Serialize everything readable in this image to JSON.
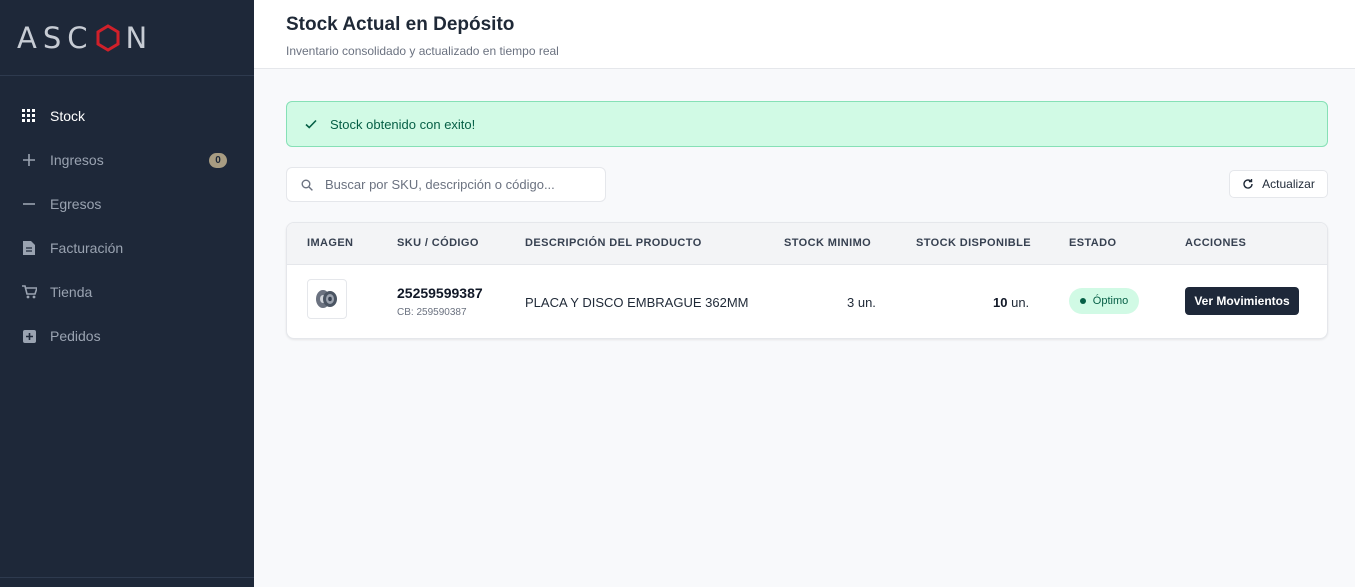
{
  "app": {
    "logo_text": "ASCON",
    "logo_accent": "#d0202a"
  },
  "sidebar": {
    "items": [
      {
        "label": "Stock",
        "icon": "grid-icon",
        "active": true
      },
      {
        "label": "Ingresos",
        "icon": "plus-icon",
        "badge": "0"
      },
      {
        "label": "Egresos",
        "icon": "minus-icon"
      },
      {
        "label": "Facturación",
        "icon": "document-icon"
      },
      {
        "label": "Tienda",
        "icon": "cart-icon"
      },
      {
        "label": "Pedidos",
        "icon": "plus-box-icon"
      }
    ]
  },
  "header": {
    "title": "Stock Actual en Depósito",
    "subtitle": "Inventario consolidado y actualizado en tiempo real"
  },
  "alert": {
    "text": "Stock obtenido con exito!",
    "icon": "check-icon"
  },
  "search": {
    "placeholder": "Buscar por SKU, descripción o código...",
    "icon": "search-icon"
  },
  "toolbar": {
    "refresh_label": "Actualizar",
    "refresh_icon": "refresh-icon"
  },
  "table": {
    "columns": [
      "IMAGEN",
      "SKU / CÓDIGO",
      "DESCRIPCIÓN DEL PRODUCTO",
      "STOCK MINIMO",
      "STOCK DISPONIBLE",
      "ESTADO",
      "ACCIONES"
    ],
    "rows": [
      {
        "image": "clutch-disc-thumbnail",
        "sku": "25259599387",
        "cb": "CB: 259590387",
        "description": "PLACA Y DISCO EMBRAGUE 362MM",
        "stock_min": "3 un.",
        "stock_available_value": "10",
        "stock_available_unit": "un.",
        "status": "Óptimo",
        "action_label": "Ver Movimientos"
      }
    ]
  },
  "colors": {
    "sidebar_bg": "#1e2839",
    "success_bg": "#d1fae5",
    "success_text": "#065f46",
    "primary_button": "#1e2839"
  }
}
